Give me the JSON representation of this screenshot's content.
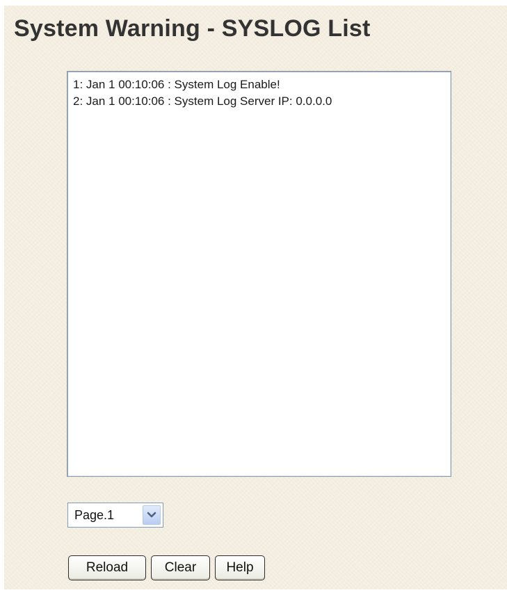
{
  "page": {
    "title": "System Warning - SYSLOG List"
  },
  "log": {
    "entries": [
      "1: Jan 1 00:10:06 : System Log Enable!",
      "2: Jan 1 00:10:06 : System Log Server IP: 0.0.0.0"
    ]
  },
  "pager": {
    "selected": "Page.1",
    "icon": "chevron-down-icon"
  },
  "buttons": {
    "reload": "Reload",
    "clear": "Clear",
    "help": "Help"
  },
  "colors": {
    "background": "#f5f0e3",
    "title": "#333333",
    "field_border": "#7f9db9",
    "dropdown_arrow": "#4d6185"
  }
}
